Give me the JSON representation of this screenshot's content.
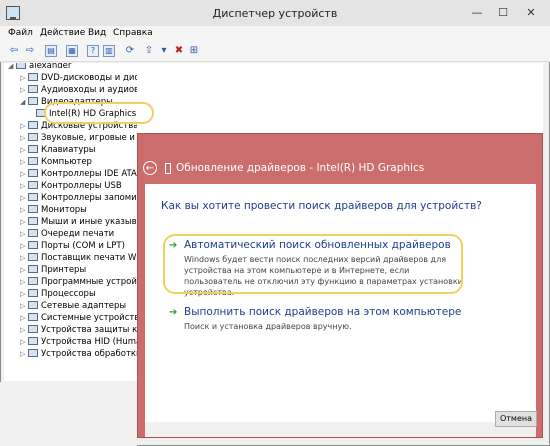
{
  "window": {
    "title": "Диспетчер устройств",
    "minimize": "—",
    "maximize": "☐",
    "close": "✕"
  },
  "menu": [
    "Файл",
    "Действие",
    "Вид",
    "Справка"
  ],
  "toolbar": {
    "back": "⇦",
    "forward": "⇨",
    "icons": [
      "properties-icon",
      "help-icon",
      "scan-icon",
      "update-driver-icon",
      "disable-icon",
      "uninstall-icon",
      "scan-hardware-icon"
    ]
  },
  "tree": {
    "root": "alexander",
    "items": [
      {
        "label": "DVD-дисководы и дисководы компакт-дисков",
        "expanded": false
      },
      {
        "label": "Аудиовходы и аудиовыходы",
        "expanded": false
      },
      {
        "label": "Видеоадаптеры",
        "expanded": true
      },
      {
        "label": "Intel(R) HD Graphics",
        "child": true
      },
      {
        "label": "Дисковые устройства",
        "expanded": false
      },
      {
        "label": "Звуковые, игровые и видеоустройства",
        "expanded": false
      },
      {
        "label": "Клавиатуры",
        "expanded": false
      },
      {
        "label": "Компьютер",
        "expanded": false
      },
      {
        "label": "Контроллеры IDE ATA/",
        "expanded": false
      },
      {
        "label": "Контроллеры USB",
        "expanded": false
      },
      {
        "label": "Контроллеры запомин",
        "expanded": false
      },
      {
        "label": "Мониторы",
        "expanded": false
      },
      {
        "label": "Мыши и иные указыва",
        "expanded": false
      },
      {
        "label": "Очереди печати",
        "expanded": false
      },
      {
        "label": "Порты (COM и LPT)",
        "expanded": false
      },
      {
        "label": "Поставщик печати WSD",
        "expanded": false
      },
      {
        "label": "Принтеры",
        "expanded": false
      },
      {
        "label": "Программные устройств",
        "expanded": false
      },
      {
        "label": "Процессоры",
        "expanded": false
      },
      {
        "label": "Сетевые адаптеры",
        "expanded": false
      },
      {
        "label": "Системные устройства",
        "expanded": false
      },
      {
        "label": "Устройства защиты ко",
        "expanded": false
      },
      {
        "label": "Устройства HID (Huma",
        "expanded": false
      },
      {
        "label": "Устройства обработки",
        "expanded": false
      }
    ]
  },
  "dialog": {
    "back": "←",
    "title": "Обновление драйверов - Intel(R) HD Graphics",
    "question": "Как вы хотите провести поиск драйверов для устройств?",
    "option_auto": {
      "arrow": "➔",
      "title": "Автоматический поиск обновленных драйверов",
      "description": "Windows будет вести поиск последних версий драйверов для устройства на этом компьютере и в Интернете, если пользователь не отключил эту функцию в параметрах установки устройства."
    },
    "option_manual": {
      "arrow": "➔",
      "title": "Выполнить поиск драйверов на этом компьютере",
      "description": "Поиск и установка драйверов вручную."
    },
    "cancel": "Отмена"
  }
}
